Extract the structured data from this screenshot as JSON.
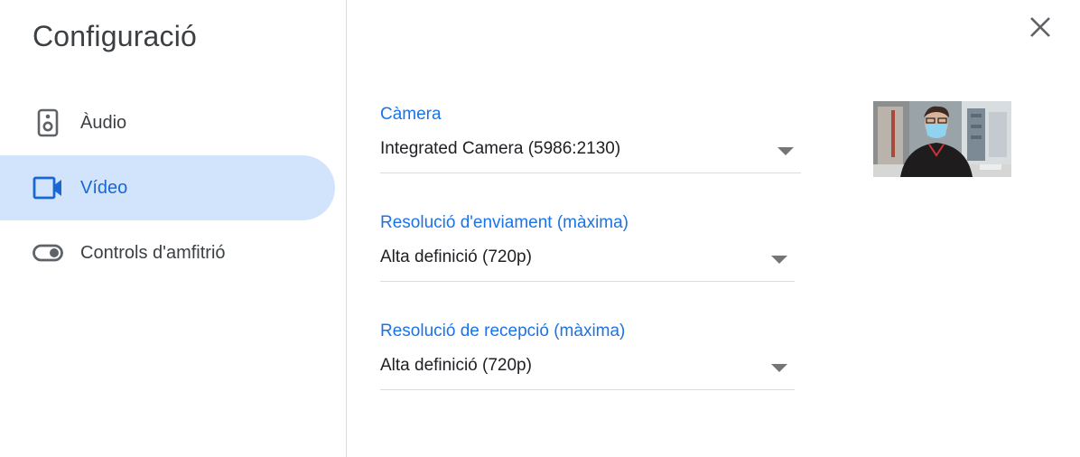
{
  "dialog": {
    "title": "Configuració",
    "close_icon": "close-icon"
  },
  "sidebar": {
    "items": [
      {
        "label": "Àudio",
        "icon": "speaker-icon",
        "active": false
      },
      {
        "label": "Vídeo",
        "icon": "video-camera-icon",
        "active": true
      },
      {
        "label": "Controls d'amfitrió",
        "icon": "toggle-icon",
        "active": false
      }
    ]
  },
  "video_settings": {
    "camera": {
      "label": "Càmera",
      "value": "Integrated Camera (5986:2130)"
    },
    "send_resolution": {
      "label": "Resolució d'enviament (màxima)",
      "value": "Alta definició (720p)"
    },
    "receive_resolution": {
      "label": "Resolució de recepció (màxima)",
      "value": "Alta definició (720p)"
    }
  },
  "colors": {
    "accent": "#1a73e8",
    "active_bg": "#d2e3fc",
    "active_text": "#1967d2",
    "text": "#3c4043"
  }
}
